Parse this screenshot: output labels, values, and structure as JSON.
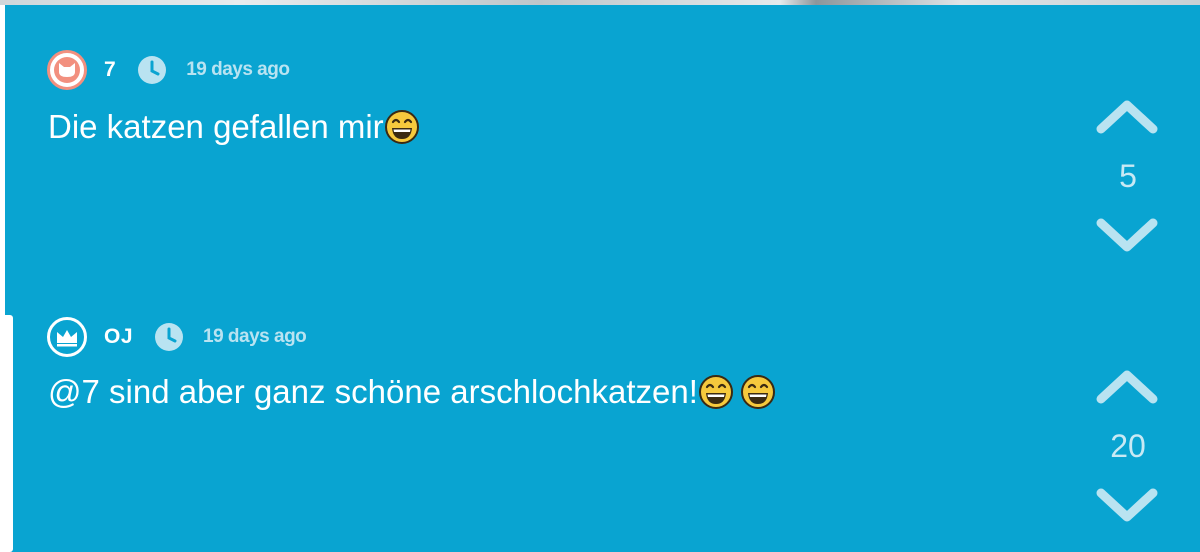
{
  "comments": [
    {
      "username": "7",
      "avatar_icon": "cat-icon",
      "avatar_color": "#f2907f",
      "time": "19 days ago",
      "text": "Die katzen gefallen mir",
      "votes": "5"
    },
    {
      "username": "OJ",
      "avatar_icon": "crown-icon",
      "avatar_color": "#ffffff",
      "time": "19 days ago",
      "text": "@7 sind aber ganz schöne arschlochkatzen! ",
      "votes": "20"
    }
  ],
  "colors": {
    "background": "#09a4d1",
    "vote_arrow": "#b9e3f1",
    "time_text": "#b9e3f1"
  }
}
